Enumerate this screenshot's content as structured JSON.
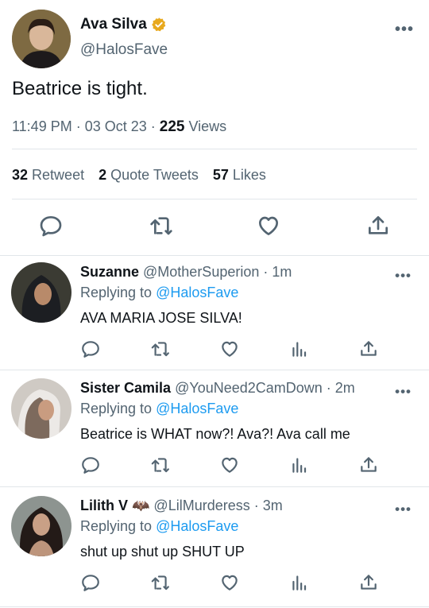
{
  "main_tweet": {
    "author_name": "Ava Silva",
    "verified_icon": "verified-badge-icon",
    "handle": "@HalosFave",
    "text": "Beatrice is tight.",
    "time": "11:49 PM",
    "date": "03 Oct 23",
    "views_count": "225",
    "views_label": "Views",
    "dot": "·",
    "stats": {
      "retweets_count": "32",
      "retweets_label": "Retweet",
      "quotes_count": "2",
      "quotes_label": "Quote Tweets",
      "likes_count": "57",
      "likes_label": "Likes"
    },
    "more": "•••"
  },
  "colors": {
    "text": "#0f1419",
    "secondary": "#536471",
    "link": "#1d9bf0",
    "verified": "#e8a91e",
    "divider": "#e1e6ea"
  },
  "replies": [
    {
      "name": "Suzanne",
      "handle": "@MotherSuperion",
      "time": "1m",
      "replying_label": "Replying to",
      "replying_handle": "@HalosFave",
      "text": "AVA MARIA JOSE SILVA!",
      "more": "•••"
    },
    {
      "name": "Sister Camila",
      "handle": "@YouNeed2CamDown",
      "time": "2m",
      "replying_label": "Replying to",
      "replying_handle": "@HalosFave",
      "text": "Beatrice is WHAT now?! Ava?! Ava call me",
      "more": "•••"
    },
    {
      "name": "Lilith V",
      "name_emoji": "🦇",
      "handle": "@LilMurderess",
      "time": "3m",
      "replying_label": "Replying to",
      "replying_handle": "@HalosFave",
      "text": "shut up shut up SHUT UP",
      "more": "•••"
    }
  ]
}
